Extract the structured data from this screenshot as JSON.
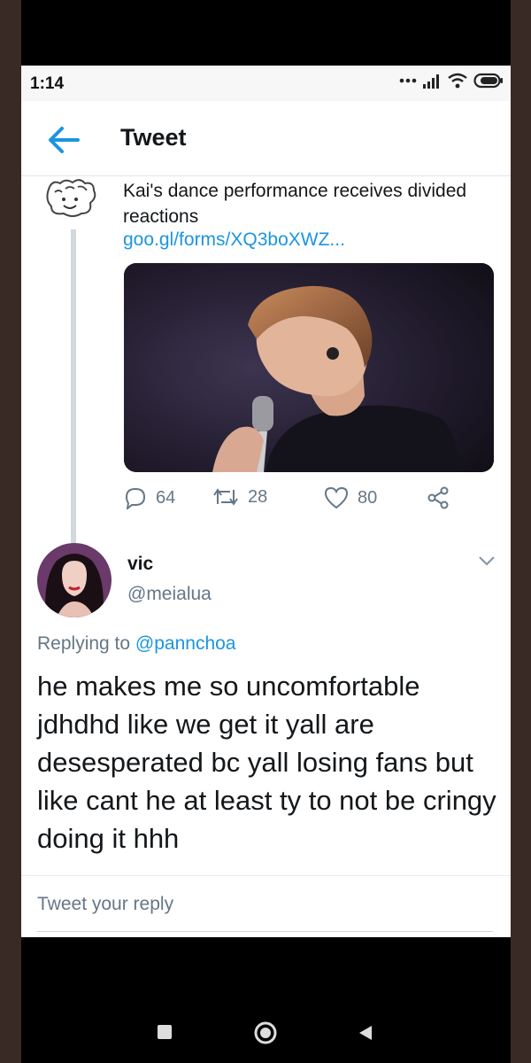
{
  "status_bar": {
    "time": "1:14",
    "icons": [
      "more-dots-icon",
      "signal-icon",
      "wifi-icon",
      "battery-icon"
    ]
  },
  "app_bar": {
    "back_icon": "arrow-left-icon",
    "title": "Tweet"
  },
  "original_tweet": {
    "text": "Kai's dance performance receives divided reactions",
    "link": "goo.gl/forms/XQ3boXWZ...",
    "actions": {
      "reply_count": "64",
      "retweet_count": "28",
      "like_count": "80"
    }
  },
  "reply_tweet": {
    "name": "vic",
    "handle": "@meialua",
    "replying_prefix": "Replying to",
    "replying_to": "@pannchoa",
    "body": "he makes me so uncomfortable jdhdhd like we get it yall are desesperated bc yall losing fans but like cant he at least ty to not be cringy doing it hhh"
  },
  "reply_composer": {
    "placeholder": "Tweet your reply"
  },
  "colors": {
    "accent": "#1b95e0",
    "text": "#14171a",
    "muted": "#657786"
  }
}
